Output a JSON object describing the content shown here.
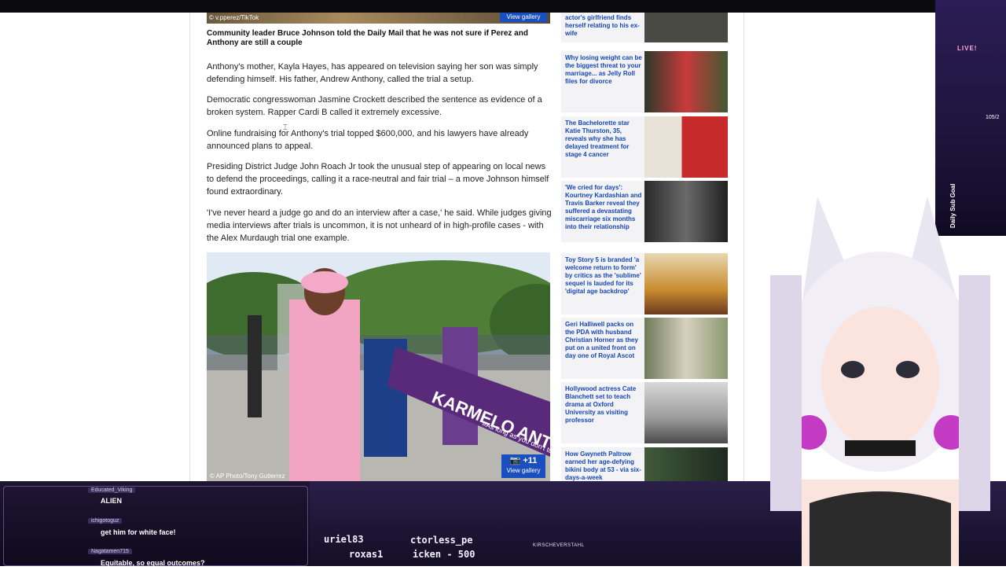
{
  "article": {
    "top_image_credit": "© v.pperez/TikTok",
    "top_view_gallery": "View gallery",
    "caption": "Community leader Bruce Johnson told the Daily Mail that he was not sure if Perez and Anthony are still a couple",
    "paragraphs": [
      "Anthony's mother, Kayla Hayes, has appeared on television saying her son was simply defending himself. His father, Andrew Anthony, called the trial a setup.",
      "Democratic congresswoman Jasmine Crockett described the sentence as evidence of a broken system. Rapper Cardi B called it extremely excessive.",
      "Online fundraising for Anthony's trial topped $600,000, and his lawyers have already announced plans to appeal.",
      "Presiding District Judge John Roach Jr took the unusual step of appearing on local news to defend the proceedings, calling it a race-neutral and fair trial – a move Johnson himself found extraordinary.",
      "'I've never heard a judge go and do an interview after a case,' he said. While judges giving media interviews after trials is uncommon, it is not unheard of in high-profile cases - with the Alex Murdaugh trial one example."
    ],
    "photo_banner_text": "KARMELO ANTHONY",
    "photo_banner_sub": "#As long as you don't touch me WE GO",
    "photo_credit": "© AP Photo/Tony Gutierrez",
    "photo_count": "+11",
    "photo_view_gallery": "View gallery"
  },
  "sidebar": {
    "items": [
      {
        "text": "actor's girlfriend finds herself relating to his ex-wife",
        "thumb_color": "#4a4a44"
      },
      {
        "text": "Why losing weight can be the biggest threat to your marriage... as Jelly Roll files for divorce",
        "thumb_color": "#2d3a2a"
      },
      {
        "text": "The Bachelorette star Katie Thurston, 35, reveals why she has delayed treatment for stage 4 cancer",
        "thumb_color": "#c62a2a"
      },
      {
        "text": "'We cried for days': Kourtney Kardashian and Travis Barker reveal they suffered a devastating miscarriage six months into their relationship",
        "thumb_color": "#2a2a2a"
      },
      {
        "text": "Toy Story 5 is branded 'a welcome return to form' by critics as the 'sublime' sequel is lauded for its 'digital age backdrop'",
        "thumb_color": "#c98b2e"
      },
      {
        "text": "Geri Halliwell packs on the PDA with husband Christian Horner as they put on a united front on day one of Royal Ascot",
        "thumb_color": "#6f7a5a"
      },
      {
        "text": "Hollywood actress Cate Blanchett set to teach drama at Oxford University as visiting professor",
        "thumb_color": "#9a9a9a"
      },
      {
        "text": "How Gwyneth Paltrow earned her age-defying bikini body at 53 - via six-days-a-week",
        "thumb_color": "#3f5a3a"
      }
    ]
  },
  "chat": {
    "messages": [
      {
        "user": "Educated_Viking",
        "text": "ALIEN"
      },
      {
        "user": "ichigotoguz",
        "text": "get him for white face!"
      },
      {
        "user": "Nagatamen715",
        "text": "Equitable, so equal outcomes?"
      }
    ]
  },
  "stream": {
    "ticker_row1_a": "uriel83",
    "ticker_row1_b": "ctorless_pe",
    "ticker_row2_a": "roxas1",
    "ticker_row2_b": "icken - 500",
    "channel": "KIRSCHEVERSTAHL",
    "live_label": "LIVE!",
    "sub_goal_label": "Daily Sub Goal",
    "sub_goal_count": "105/2"
  },
  "colors": {
    "link": "#1447b8",
    "gallery_button": "#1a4fbf",
    "overlay_bg": "#1b1236"
  }
}
